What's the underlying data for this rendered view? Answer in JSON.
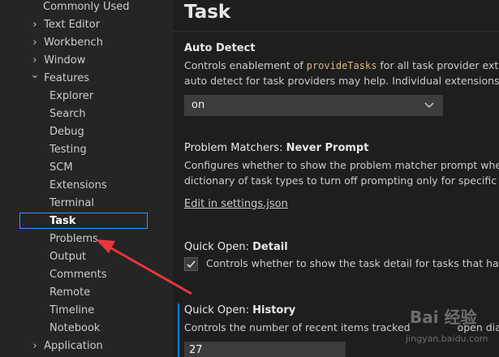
{
  "sidebar": {
    "items": [
      {
        "label": "Commonly Used",
        "chevron": ""
      },
      {
        "label": "Text Editor",
        "chevron": "›"
      },
      {
        "label": "Workbench",
        "chevron": "›"
      },
      {
        "label": "Window",
        "chevron": "›"
      },
      {
        "label": "Features",
        "chevron": "⌄"
      },
      {
        "label": "Explorer"
      },
      {
        "label": "Search"
      },
      {
        "label": "Debug"
      },
      {
        "label": "Testing"
      },
      {
        "label": "SCM"
      },
      {
        "label": "Extensions"
      },
      {
        "label": "Terminal"
      },
      {
        "label": "Task"
      },
      {
        "label": "Problems"
      },
      {
        "label": "Output"
      },
      {
        "label": "Comments"
      },
      {
        "label": "Remote"
      },
      {
        "label": "Timeline"
      },
      {
        "label": "Notebook"
      },
      {
        "label": "Application",
        "chevron": "›"
      }
    ],
    "selected": "Task"
  },
  "editor": {
    "title": "Task",
    "auto_detect": {
      "title": "Auto Detect",
      "desc1_pre": "Controls enablement of ",
      "desc1_code": "provideTasks",
      "desc1_post": " for all task provider extensic",
      "desc2": "auto detect for task providers may help. Individual extensions may a",
      "value": "on",
      "chevron": "⌄"
    },
    "problem_matchers": {
      "category": "Problem Matchers: ",
      "name": "Never Prompt",
      "desc1": "Configures whether to show the problem matcher prompt when rur",
      "desc2": "dictionary of task types to turn off prompting only for specific task t",
      "link": "Edit in settings.json"
    },
    "quick_open_detail": {
      "category": "Quick Open: ",
      "name": "Detail",
      "checked": true,
      "label": "Controls whether to show the task detail for tasks that have a d"
    },
    "quick_open_history": {
      "category": "Quick Open: ",
      "name": "History",
      "desc": "Controls the number of recent items tracked",
      "desc_tail": "open dialo",
      "value": "27"
    }
  },
  "watermark": {
    "text": "Bai 经验",
    "url": "jingyan.baidu.com"
  },
  "colors": {
    "sidebar_bg": "#252526",
    "editor_bg": "#1e1e1e",
    "focus_border": "#3794ff",
    "arrow": "#e8373b",
    "code": "#d7ba7d"
  }
}
